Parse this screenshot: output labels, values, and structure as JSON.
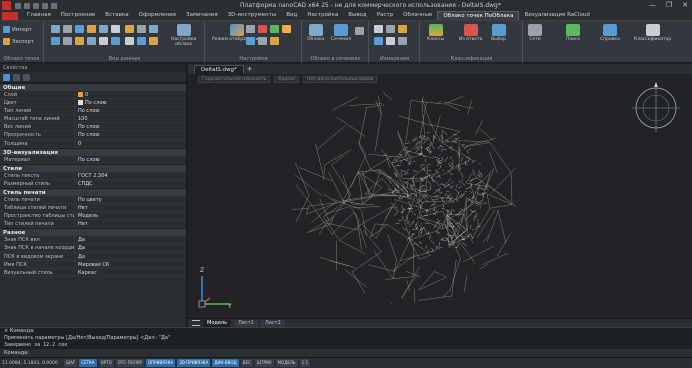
{
  "app": {
    "title": "Платформа nanoCAD x64 25 - не для коммерческого использования - DeltaIS.dwg*",
    "window_buttons": [
      "—",
      "❐",
      "✕"
    ]
  },
  "menu_tabs": [
    "Главная",
    "Построение",
    "Вставка",
    "Оформление",
    "Замечания",
    "3D-инструменты",
    "Вид",
    "Настройка",
    "Вывод",
    "Растр",
    "Облачные",
    "Облако точек ПоОблака",
    "Визуализация RaCloud"
  ],
  "active_menu_tab_index": 11,
  "ribbon": {
    "groups": [
      {
        "label": "Облако точек",
        "buttons": [
          "Импорт",
          "Экспорт"
        ]
      },
      {
        "label": "Вид данных",
        "buttons": [
          "Настройка",
          "облака"
        ]
      },
      {
        "label": "Настройки",
        "buttons": [
          "Режим отображения"
        ]
      },
      {
        "label": "Облако в сечениях",
        "buttons": [
          "Облако",
          "Сечения"
        ]
      },
      {
        "label": "Измерения",
        "buttons": [
          "Измерения"
        ]
      },
      {
        "label": "Классификация",
        "buttons": [
          "Классы",
          "Из ответа",
          "Выбор"
        ]
      },
      {
        "label": "",
        "buttons": [
          "Сети",
          "Поиск",
          "Справка",
          "Классификатор"
        ]
      }
    ]
  },
  "file_tabs": [
    "DeltaIS.dwg*"
  ],
  "viewport_bar": [
    "Горизонтальная плоскость",
    "Каркас",
    "Нет дополнительных видов"
  ],
  "properties": {
    "header": "Свойства",
    "sections": [
      {
        "title": "Общие",
        "rows": [
          {
            "k": "Слой",
            "v": "0"
          },
          {
            "k": "Цвет",
            "v": "По слою"
          },
          {
            "k": "Тип линий",
            "v": "По слою"
          },
          {
            "k": "Масштаб типа линий",
            "v": "100"
          },
          {
            "k": "Вес линий",
            "v": "По слою"
          },
          {
            "k": "Прозрачность",
            "v": "По слою"
          },
          {
            "k": "Толщина",
            "v": "0"
          }
        ]
      },
      {
        "title": "3D-визуализация",
        "rows": [
          {
            "k": "Материал",
            "v": "По слою"
          }
        ]
      },
      {
        "title": "Стили",
        "rows": [
          {
            "k": "Стиль текста",
            "v": "ГОСТ 2.304"
          },
          {
            "k": "Размерный стиль",
            "v": "СПДС"
          }
        ]
      },
      {
        "title": "Стиль печати",
        "rows": [
          {
            "k": "Стиль печати",
            "v": "По цвету"
          },
          {
            "k": "Таблица стилей печати",
            "v": "Нет"
          },
          {
            "k": "Пространство таблицы стилей печати",
            "v": "Модель"
          },
          {
            "k": "Тип стилей печати",
            "v": "Нет"
          }
        ]
      },
      {
        "title": "Разное",
        "rows": [
          {
            "k": "Знак ПСК вкл",
            "v": "Да"
          },
          {
            "k": "Знак ПСК в начале координат",
            "v": "Да"
          },
          {
            "k": "ПСК в видовом экране",
            "v": "Да"
          },
          {
            "k": "Имя ПСК",
            "v": "Мировая СК"
          },
          {
            "k": "Визуальный стиль",
            "v": "Каркас"
          }
        ]
      }
    ]
  },
  "layout_tabs": [
    "Модель",
    "Лист1",
    "Лист2"
  ],
  "active_layout_index": 0,
  "command": {
    "lines": [
      "× Команда:",
      "Применить параметры [Да/Нет/Выход/Параметры] <Да>: \"Да\"",
      "Завершено за 12.2 сек"
    ],
    "input_label": "Команда:"
  },
  "status": {
    "coords": "11.0084, 5.1843, 0.0000",
    "buttons": [
      "ШАГ",
      "СЕТКА",
      "ОРТО",
      "ОТС-ПОЛЯР",
      "ОПРИВЯЗКА",
      "3D-ПРИВЯЗКА",
      "ДИН-ВВОД",
      "ВЕС",
      "ШТРИХ",
      "МОДЕЛЬ",
      "1:1"
    ],
    "on_indices": [
      1,
      4,
      5,
      6
    ]
  },
  "axis_labels": {
    "z": "Z",
    "y": "Y"
  },
  "colors": {
    "accent": "#2f6ba8",
    "viewport": "#212326",
    "cloud": "#d8d2b0"
  }
}
